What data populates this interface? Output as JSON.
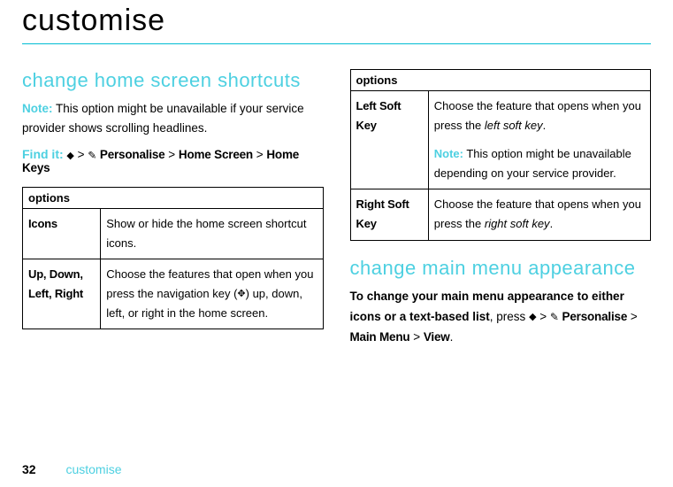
{
  "page": {
    "title": "customise",
    "number": "32",
    "footer_section": "customise"
  },
  "left": {
    "heading": "change home screen shortcuts",
    "note_label": "Note:",
    "note_text": " This option might be unavailable if your service provider shows scrolling headlines.",
    "findit_label": "Find it:",
    "path": {
      "center_icon": "◆",
      "gt1": " > ",
      "tool_icon": "✎",
      "personalise": " Personalise",
      "gt2": " > ",
      "home_screen": "Home Screen",
      "gt3": " > ",
      "home_keys": "Home Keys"
    },
    "table": {
      "header": "options",
      "rows": [
        {
          "label": "Icons",
          "desc": "Show or hide the home screen shortcut icons."
        },
        {
          "label": "Up, Down, Left, Right",
          "desc_pre": "Choose the features that open when you press the navigation key (",
          "nav_icon": "✥",
          "desc_post": ") up, down, left, or right in the home screen."
        }
      ]
    }
  },
  "right": {
    "table": {
      "header": "options",
      "rows": [
        {
          "label": "Left Soft Key",
          "desc_pre": "Choose the feature that opens when you press the ",
          "italic": "left soft key",
          "desc_post": ".",
          "note_label": "Note:",
          "note_text": " This option might be unavailable depending on your service provider."
        },
        {
          "label": "Right Soft Key",
          "desc_pre": "Choose the feature that opens when you press the ",
          "italic": "right soft key",
          "desc_post": "."
        }
      ]
    },
    "heading": "change main menu appearance",
    "para_bold": "To change your main menu appearance to either icons or a text-based list",
    "para_mid": ", press ",
    "center_icon": "◆",
    "gt1": " > ",
    "tool_icon": "✎",
    "personalise": " Personalise",
    "gt2": " > ",
    "main_menu": "Main Menu",
    "gt3": " > ",
    "view": "View",
    "period": "."
  }
}
